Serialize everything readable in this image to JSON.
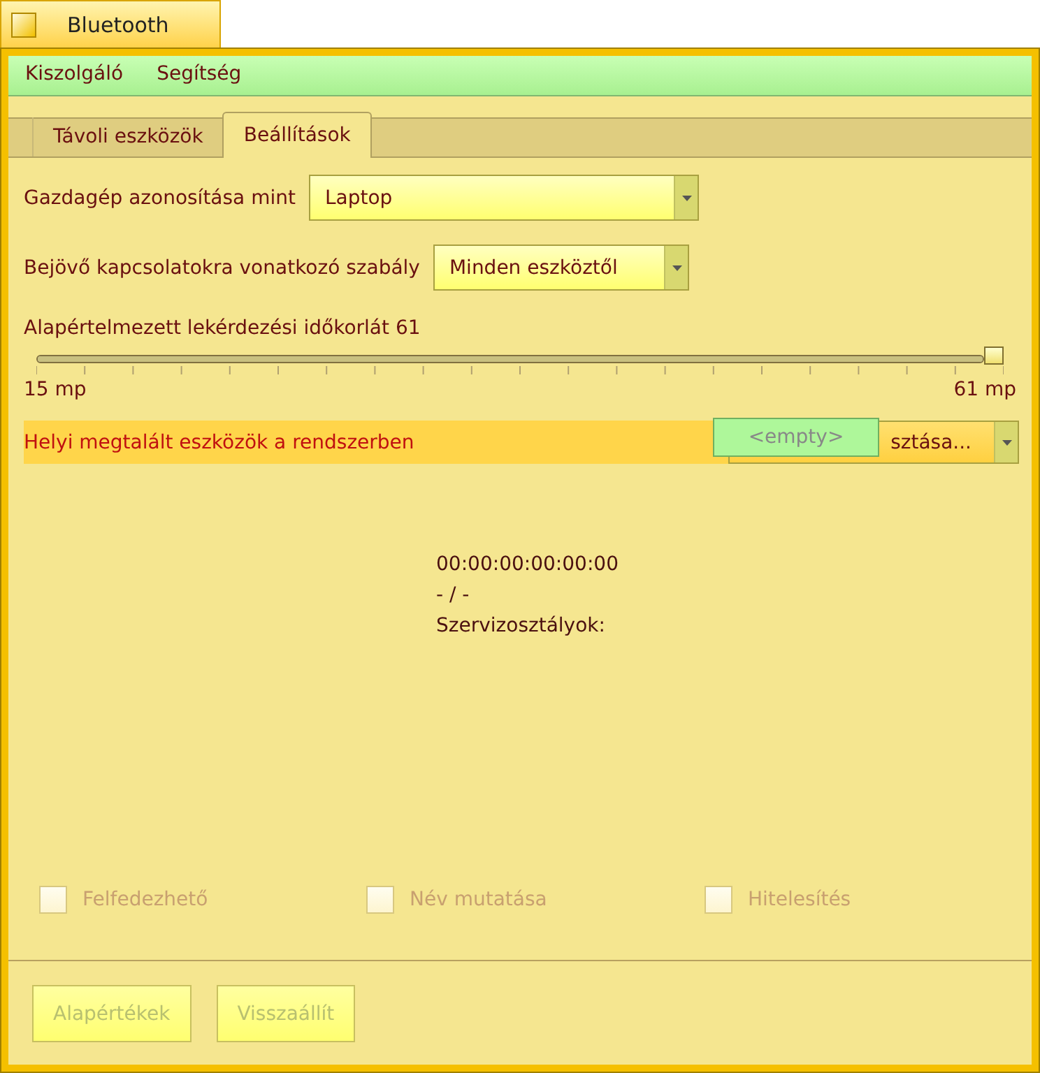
{
  "window": {
    "title": "Bluetooth"
  },
  "menu": [
    "Kiszolgáló",
    "Segítség"
  ],
  "tabs": [
    {
      "label": "Távoli eszközök",
      "selected": false
    },
    {
      "label": "Beállítások",
      "selected": true
    }
  ],
  "settings": [
    {
      "label": "Gazdagép azonosítása mint",
      "value": "Laptop"
    },
    {
      "label": "Bejövő kapcsolatokra vonatkozó szabály",
      "value": "Minden eszköztől"
    }
  ],
  "timeout": {
    "label": "Alapértelmezett lekérdezési időkorlát 61",
    "level": 1,
    "min_label": "15 mp",
    "max_label": "61 mp"
  },
  "local_devices": {
    "label": "Helyi megtalált eszközök a rendszerben",
    "value": "sztása...",
    "popup": "<empty>"
  },
  "device_info": [
    "00:00:00:00:00:00",
    "- / -",
    "Szervizosztályok:"
  ],
  "options": [
    {
      "label": "Felfedezhető",
      "checked": false,
      "disabled": true
    },
    {
      "label": "Név mutatása",
      "checked": false,
      "disabled": true
    },
    {
      "label": "Hitelesítés",
      "checked": false,
      "disabled": true
    }
  ],
  "buttons": [
    {
      "label": "Alapértékek",
      "disabled": true
    },
    {
      "label": "Visszaállít",
      "disabled": true
    }
  ]
}
